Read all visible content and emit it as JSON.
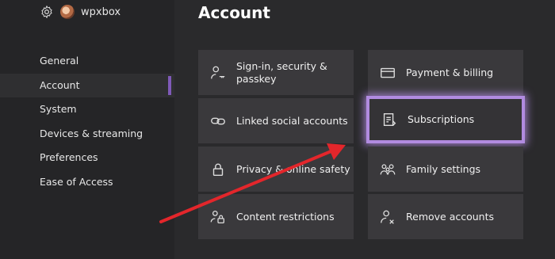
{
  "header": {
    "username": "wpxbox",
    "page_title": "Account"
  },
  "sidebar": {
    "items": [
      {
        "label": "General"
      },
      {
        "label": "Account"
      },
      {
        "label": "System"
      },
      {
        "label": "Devices & streaming"
      },
      {
        "label": "Preferences"
      },
      {
        "label": "Ease of Access"
      }
    ]
  },
  "tiles": [
    {
      "label": "Sign-in, security & passkey",
      "icon": "person-key-icon"
    },
    {
      "label": "Linked social accounts",
      "icon": "link-icon"
    },
    {
      "label": "Privacy & online safety",
      "icon": "lock-icon"
    },
    {
      "label": "Content restrictions",
      "icon": "people-lock-icon"
    },
    {
      "label": "Payment & billing",
      "icon": "credit-card-icon"
    },
    {
      "label": "Subscriptions",
      "icon": "subscriptions-icon"
    },
    {
      "label": "Family settings",
      "icon": "family-icon"
    },
    {
      "label": "Remove accounts",
      "icon": "remove-person-icon"
    }
  ],
  "colors": {
    "highlight": "#b18be0",
    "arrow": "#e3262b",
    "accent": "#7f5ab8"
  }
}
